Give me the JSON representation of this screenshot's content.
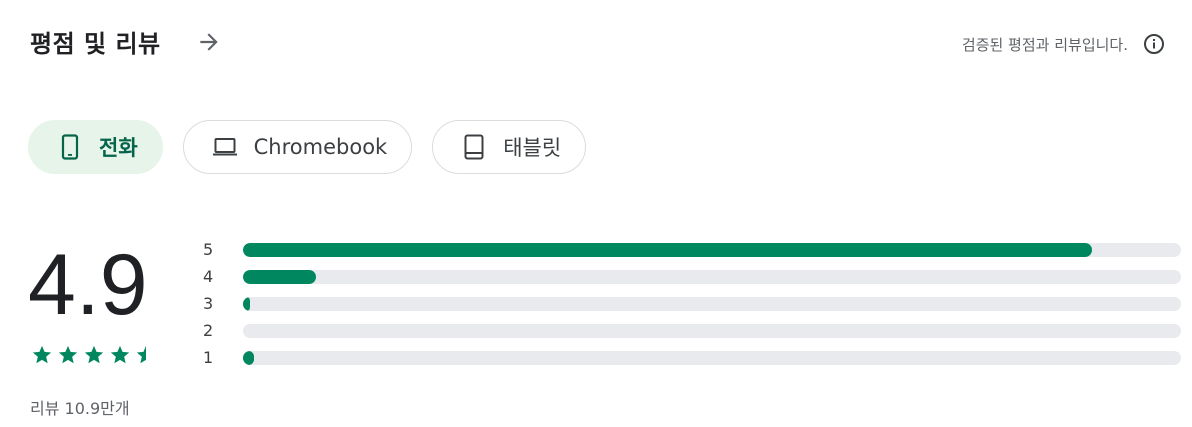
{
  "header": {
    "title": "평점 및 리뷰",
    "verified_text": "검증된 평점과 리뷰입니다.",
    "arrow_icon": "arrow-right-icon",
    "info_icon": "info-icon"
  },
  "device_tabs": [
    {
      "label": "전화",
      "icon": "phone-icon",
      "active": true
    },
    {
      "label": "Chromebook",
      "icon": "laptop-icon",
      "active": false
    },
    {
      "label": "태블릿",
      "icon": "tablet-icon",
      "active": false
    }
  ],
  "rating": {
    "score": "4.9",
    "stars": 4.5,
    "review_count": "리뷰 10.9만개"
  },
  "distribution": [
    {
      "label": "5",
      "fraction": 0.905
    },
    {
      "label": "4",
      "fraction": 0.078
    },
    {
      "label": "3",
      "fraction": 0.007
    },
    {
      "label": "2",
      "fraction": 0.0
    },
    {
      "label": "1",
      "fraction": 0.012
    }
  ],
  "colors": {
    "accent": "#01875f",
    "chip_active_bg": "#e6f4ea",
    "track": "#e8eaed"
  }
}
